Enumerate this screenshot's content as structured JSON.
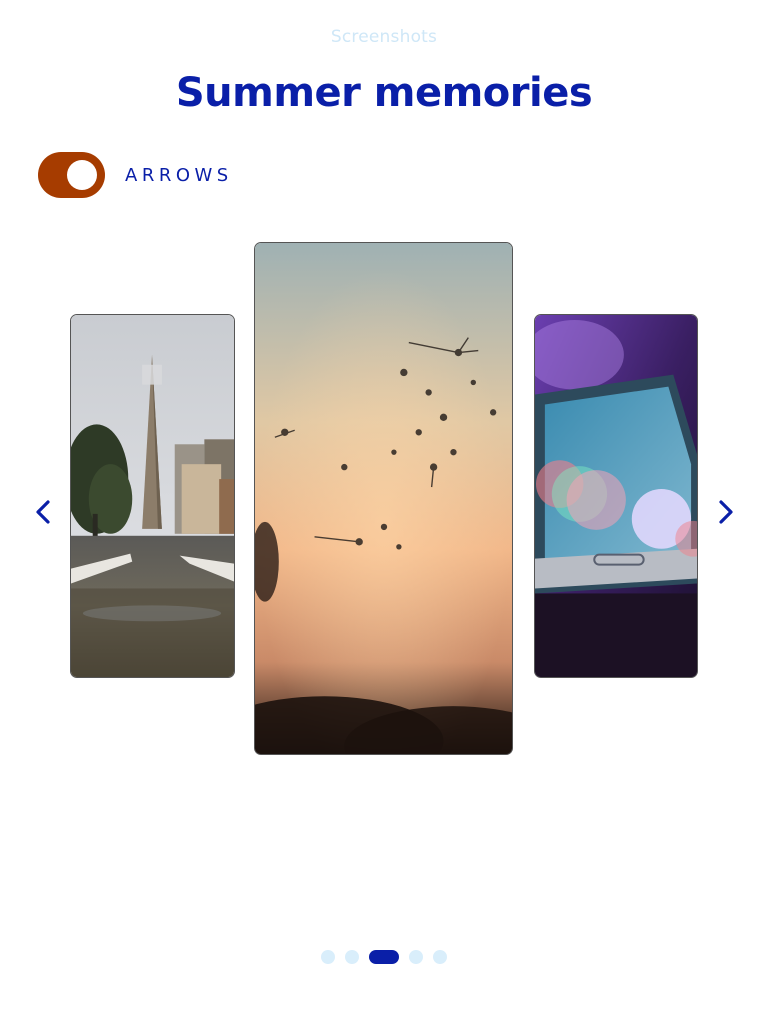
{
  "header": {
    "eyebrow": "Screenshots",
    "title": "Summer memories"
  },
  "toggle": {
    "label": "ARROWS",
    "on": true,
    "color": "#a63c00"
  },
  "carousel": {
    "prev_icon": "chevron-left-icon",
    "next_icon": "chevron-right-icon",
    "slides": [
      {
        "name": "city-street-photo"
      },
      {
        "name": "dandelion-sunset-photo"
      },
      {
        "name": "smartphone-bokeh-photo"
      }
    ],
    "active_index": 2,
    "total": 5
  },
  "colors": {
    "accent": "#0a1fa8",
    "eyebrow": "#cfe7f7",
    "dot_inactive": "#d9eefb"
  }
}
